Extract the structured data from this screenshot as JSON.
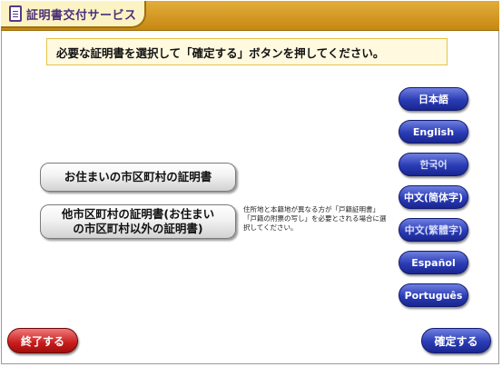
{
  "header": {
    "title": "証明書交付サービス",
    "icon": "document-icon"
  },
  "instruction": "必要な証明書を選択して「確定する」ボタンを押してください。",
  "certificates": {
    "home": "お住まいの市区町村の証明書",
    "other_line1": "他市区町村の証明書(お住まい",
    "other_line2": "の市区町村以外の証明書)",
    "other_note": "住所地と本籍地が異なる方が「戸籍証明書」「戸籍の附票の写し」を必要とされる場合に選択してください。"
  },
  "languages": [
    {
      "label": "日本語"
    },
    {
      "label": "English"
    },
    {
      "label": "한국어"
    },
    {
      "label": "中文(简体字)"
    },
    {
      "label": "中文(繁體字)"
    },
    {
      "label": "Español"
    },
    {
      "label": "Português"
    }
  ],
  "footer": {
    "end_label": "終了する",
    "confirm_label": "確定する"
  },
  "colors": {
    "header": "#d59a22",
    "language_button": "#2a3cb5",
    "end_button": "#c81c1c",
    "confirm_button": "#2a3cb5"
  }
}
